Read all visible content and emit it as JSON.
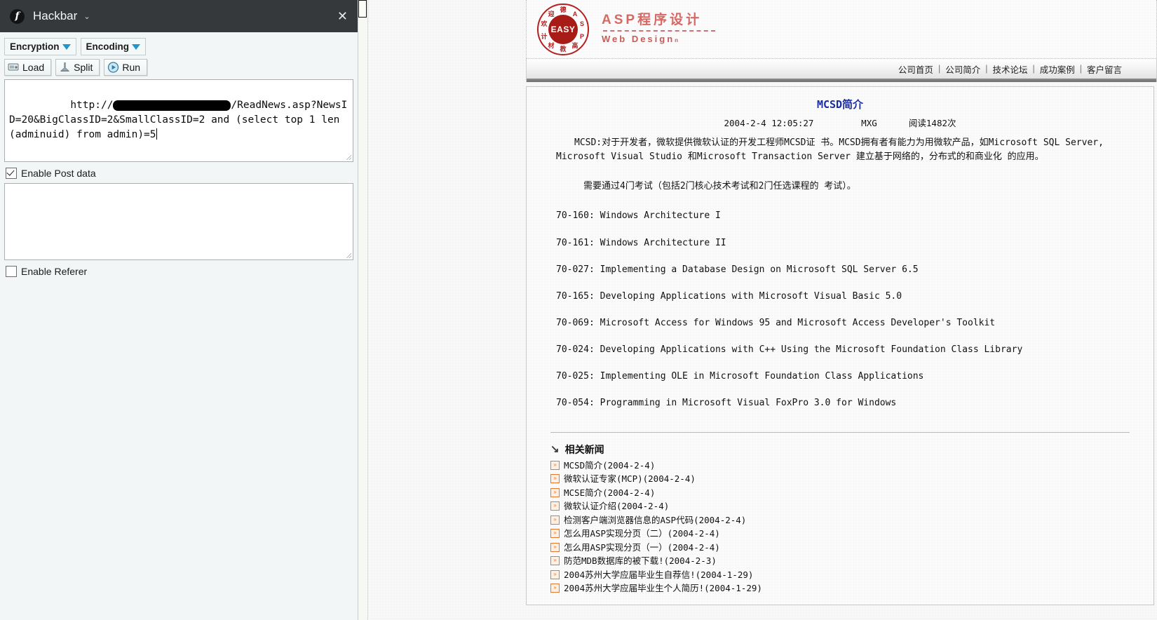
{
  "hackbar": {
    "title": "Hackbar",
    "logo_char": "f",
    "caret": "⌄",
    "close": "✕",
    "dropdowns": [
      {
        "label": "Encryption",
        "name": "encryption-dropdown"
      },
      {
        "label": "Encoding",
        "name": "encoding-dropdown"
      }
    ],
    "buttons": [
      {
        "label": "Load",
        "icon": "load-icon"
      },
      {
        "label": "Split",
        "icon": "split-icon"
      },
      {
        "label": "Run",
        "icon": "run-icon"
      }
    ],
    "url_field": {
      "prefix": "http://",
      "redacted": true,
      "suffix": "/ReadNews.asp?NewsID=20&BigClassID=2&SmallClassID=2 and (select top 1 len(adminuid) from admin)=5",
      "placeholder": ""
    },
    "post_field": {
      "value": "",
      "placeholder": ""
    },
    "checkboxes": [
      {
        "label": "Enable Post data",
        "checked": true
      },
      {
        "label": "Enable Referer",
        "checked": false
      }
    ]
  },
  "site": {
    "logo": {
      "seal_text": "EASY",
      "seal_ring": [
        "德",
        "A",
        "S",
        "P",
        "高",
        "教",
        "材",
        "计",
        "欢",
        "迎"
      ],
      "title": "ASP程序设计",
      "subtitle": "Web Design",
      "subtitle_tiny": "n"
    },
    "nav": {
      "separator": "|",
      "items": [
        "公司首页",
        "公司简介",
        "技术论坛",
        "成功案例",
        "客户留言"
      ]
    },
    "article": {
      "title": "MCSD简介",
      "meta": "2004-2-4 12:05:27         MXG      阅读1482次",
      "date": "2004-2-4 12:05:27",
      "author": "MXG",
      "views": "阅读1482次",
      "paragraphs": [
        "MCSD:对于开发者，微软提供微软认证的开发工程师MCSD证 书。MCSD拥有者有能力为用微软产品，如Microsoft SQL Server, Microsoft Visual Studio 和Microsoft Transaction Server 建立基于网络的，分布式的和商业化 的应用。",
        "需要通过4门考试（包括2门核心技术考试和2门任选课程的 考试）。"
      ],
      "exams": [
        "70-160: Windows Architecture I",
        "70-161: Windows Architecture II",
        "70-027: Implementing a Database Design on Microsoft SQL Server 6.5",
        "70-165: Developing Applications with Microsoft Visual Basic 5.0",
        "70-069: Microsoft Access for Windows 95 and Microsoft Access Developer's Toolkit",
        "70-024: Developing Applications with C++ Using the Microsoft Foundation Class Library",
        "70-025: Implementing OLE in Microsoft Foundation Class Applications",
        "70-054: Programming in Microsoft Visual FoxPro 3.0 for Windows"
      ]
    },
    "related": {
      "heading": "相关新闻",
      "arrow": "↘",
      "bullet": "»",
      "items": [
        "MCSD简介(2004-2-4)",
        "微软认证专家(MCP)(2004-2-4)",
        "MCSE简介(2004-2-4)",
        "微软认证介绍(2004-2-4)",
        "检测客户端浏览器信息的ASP代码(2004-2-4)",
        "怎么用ASP实现分页（二）(2004-2-4)",
        "怎么用ASP实现分页（一）(2004-2-4)",
        "防范MDB数据库的被下载!(2004-2-3)",
        "2004苏州大学应届毕业生自荐信!(2004-1-29)",
        "2004苏州大学应届毕业生个人简历!(2004-1-29)"
      ]
    }
  },
  "colors": {
    "titlebar": "#36393b",
    "accent_blue": "#2196c9",
    "link_blue": "#1b2ea0",
    "seal_red": "#a81c18",
    "bullet_orange": "#e8762d"
  }
}
